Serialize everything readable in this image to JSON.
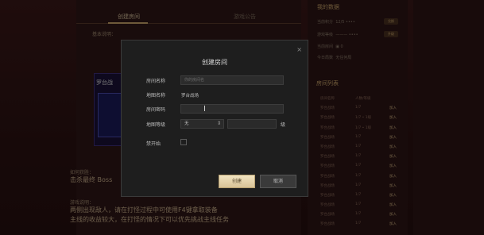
{
  "background": {
    "tabs": {
      "create": "创建房间",
      "notice": "游戏公告"
    },
    "basic_section": "基本说明：",
    "game_title": "罗台战",
    "hint1_label": "如何获胜：",
    "hint1": "击杀最终 Boss",
    "hint2_label": "游戏说明：",
    "hint2": "两侧出现敌人，请在打怪过程中可使用F4键拿取装备",
    "hint3": "主线的收益较大，在打怪的情况下可以优先挑战主线任务"
  },
  "right_panel": {
    "title": "我的数据",
    "rows": [
      {
        "label": "当前积分",
        "value": "12/5 ••••",
        "btn": "兑换"
      },
      {
        "label": "游戏等级",
        "value": "——— ••••",
        "btn": "升级"
      },
      {
        "label": "当前房间",
        "value": "▣ 0",
        "btn": ""
      },
      {
        "label": "今日局数",
        "value": "无任何局",
        "btn": ""
      }
    ],
    "room_list_title": "房间列表",
    "rooms": [
      {
        "name": "房间名称",
        "info": "人数/等级",
        "action": ""
      },
      {
        "name": "罗台战场",
        "info": "1/7",
        "action": "加入"
      },
      {
        "name": "罗台战场",
        "info": "1/7 • 1级",
        "action": "加入"
      },
      {
        "name": "罗台战场",
        "info": "1/7 • 1级",
        "action": "加入"
      },
      {
        "name": "罗台战场",
        "info": "1/7",
        "action": "加入"
      },
      {
        "name": "罗台战场",
        "info": "1/7",
        "action": "加入"
      },
      {
        "name": "罗台战场",
        "info": "1/7",
        "action": "加入"
      },
      {
        "name": "罗台战场",
        "info": "1/7",
        "action": "加入"
      },
      {
        "name": "罗台战场",
        "info": "1/7",
        "action": "加入"
      },
      {
        "name": "罗台战场",
        "info": "1/7",
        "action": "加入"
      },
      {
        "name": "罗台战场",
        "info": "1/7",
        "action": "加入"
      },
      {
        "name": "罗台战场",
        "info": "1/7",
        "action": "加入"
      },
      {
        "name": "罗台战场",
        "info": "1/7",
        "action": "加入"
      },
      {
        "name": "罗台战场",
        "info": "1/7",
        "action": "加入"
      }
    ]
  },
  "modal": {
    "title": "创建房间",
    "close": "×",
    "room_name_label": "房间名称",
    "room_name_placeholder": "你的房间名",
    "map_name_label": "地图名称",
    "map_name_value": "罗台战场",
    "password_label": "房间密码",
    "map_level_label": "地图等级",
    "map_level_value": "无",
    "unit": "级",
    "spectate_label": "禁开始",
    "confirm": "创建",
    "cancel": "取消"
  }
}
